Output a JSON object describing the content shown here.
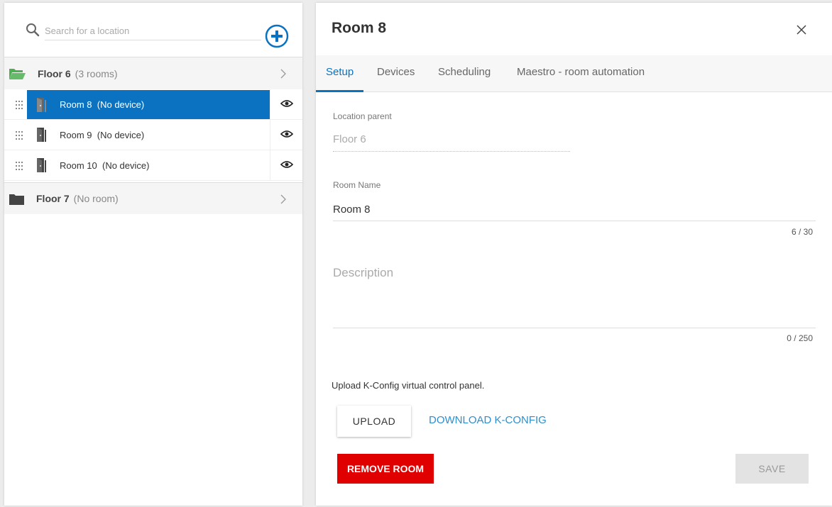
{
  "search": {
    "placeholder": "Search for a location"
  },
  "icons": {
    "search": "search-icon",
    "add": "add-location-icon",
    "folder_open": "folder-open-icon",
    "folder_closed": "folder-icon",
    "chevron": "chevron-right-icon",
    "drag": "drag-handle-icon",
    "door": "door-icon",
    "eye": "eye-icon",
    "close": "close-icon"
  },
  "colors": {
    "accent": "#0a72c0",
    "folder_open": "#4caf50",
    "folder_closed": "#444444",
    "danger": "#e00000",
    "link": "#2c8fcf"
  },
  "tree": {
    "floors": [
      {
        "name": "Floor 6",
        "count": "(3 rooms)",
        "expanded": true,
        "rooms": [
          {
            "name": "Room 8",
            "status": "(No device)",
            "selected": true
          },
          {
            "name": "Room 9",
            "status": "(No device)",
            "selected": false
          },
          {
            "name": "Room 10",
            "status": "(No device)",
            "selected": false
          }
        ]
      },
      {
        "name": "Floor 7",
        "count": "(No room)",
        "expanded": false,
        "rooms": []
      }
    ]
  },
  "detail": {
    "title": "Room 8",
    "tabs": [
      "Setup",
      "Devices",
      "Scheduling",
      "Maestro - room automation"
    ],
    "active_tab": "Setup",
    "location_parent": {
      "label": "Location parent",
      "value": "Floor 6"
    },
    "room_name": {
      "label": "Room Name",
      "value": "Room 8",
      "counter": "6 / 30"
    },
    "description": {
      "placeholder": "Description",
      "value": "",
      "counter": "0 / 250"
    },
    "upload_text": "Upload K-Config virtual control panel.",
    "upload_label": "UPLOAD",
    "download_label": "DOWNLOAD K-CONFIG",
    "remove_label": "REMOVE ROOM",
    "save_label": "SAVE"
  }
}
